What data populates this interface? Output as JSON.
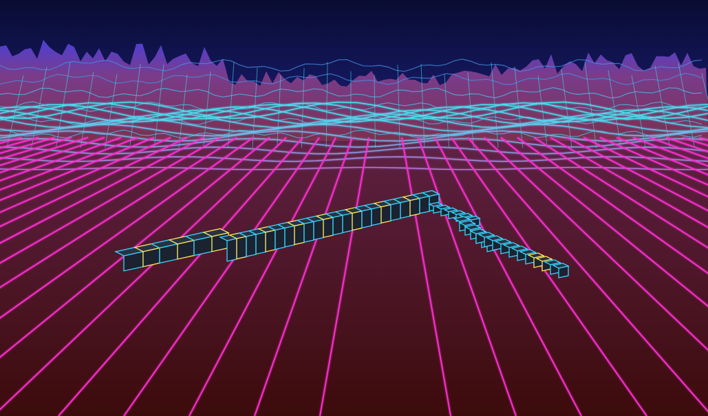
{
  "scene": {
    "kind": "synthwave-3d-game-view",
    "colors": {
      "sky_top": "#0b0f3a",
      "sky_horizon": "#1a1a6e",
      "ground_near": "#3a0a0a",
      "ground_far": "#5a1a3a",
      "grid_near": "#ff2fd4",
      "grid_far": "#3fe8f0",
      "mountain_fill": "#7a3a6a",
      "mountain_peak": "#4a3ad8",
      "block_fill": "#1b2230",
      "block_edge_cyan": "#35d7ff",
      "block_edge_yellow": "#ffe65a"
    },
    "objects": [
      "terrain-grid",
      "mountain-range",
      "block-structure"
    ]
  }
}
